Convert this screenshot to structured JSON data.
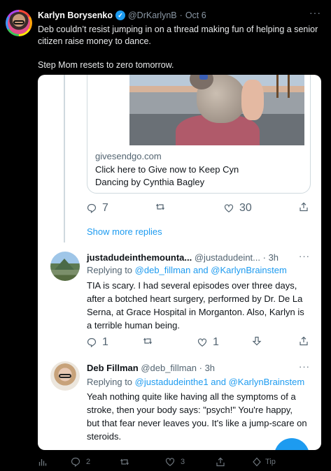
{
  "outer_tweet": {
    "name": "Karlyn Borysenko",
    "handle": "@DrKarlynB",
    "dot": "·",
    "date": "Oct 6",
    "more": "···",
    "text_line1": "Deb couldn’t resist jumping in on a thread making fun of helping a senior citizen raise money to dance.",
    "text_line2": "Step Mom resets to zero tomorrow.",
    "actions": {
      "replies": "2",
      "likes": "3",
      "tip": "Tip"
    }
  },
  "screenshot": {
    "link_card": {
      "domain": "givesendgo.com",
      "title": "Click here to Give now to Keep Cyn Dancing by Cynthia Bagley"
    },
    "top_actions": {
      "replies": "7",
      "likes": "30"
    },
    "show_more": "Show more replies",
    "reply1": {
      "name": "justadudeinthemounta...",
      "handle": "@justadudeint...",
      "time": "· 3h",
      "more": "···",
      "replying_prefix": "Replying to",
      "replying_to": "@deb_fillman and @KarlynBrainstem",
      "text": "TIA is scary. I had several episodes over three days, after a botched heart surgery, performed by Dr. De La Serna, at Grace Hospital in Morganton. Also, Karlyn is a terrible human being.",
      "replies": "1",
      "likes": "1"
    },
    "reply2": {
      "name": "Deb Fillman",
      "handle": "@deb_fillman",
      "time": "· 3h",
      "more": "···",
      "replying_prefix": "Replying to",
      "replying_to": "@justadudeinthe1 and @KarlynBrainstem",
      "text": "Yeah nothing quite like having all the symptoms of a stroke, then your body says: \"psych!\" You're happy, but that fear never leaves you. It's like a jump-scare on steroids."
    }
  },
  "colors": {
    "accent": "#1d9bf0",
    "background": "#000000",
    "card": "#ffffff"
  }
}
